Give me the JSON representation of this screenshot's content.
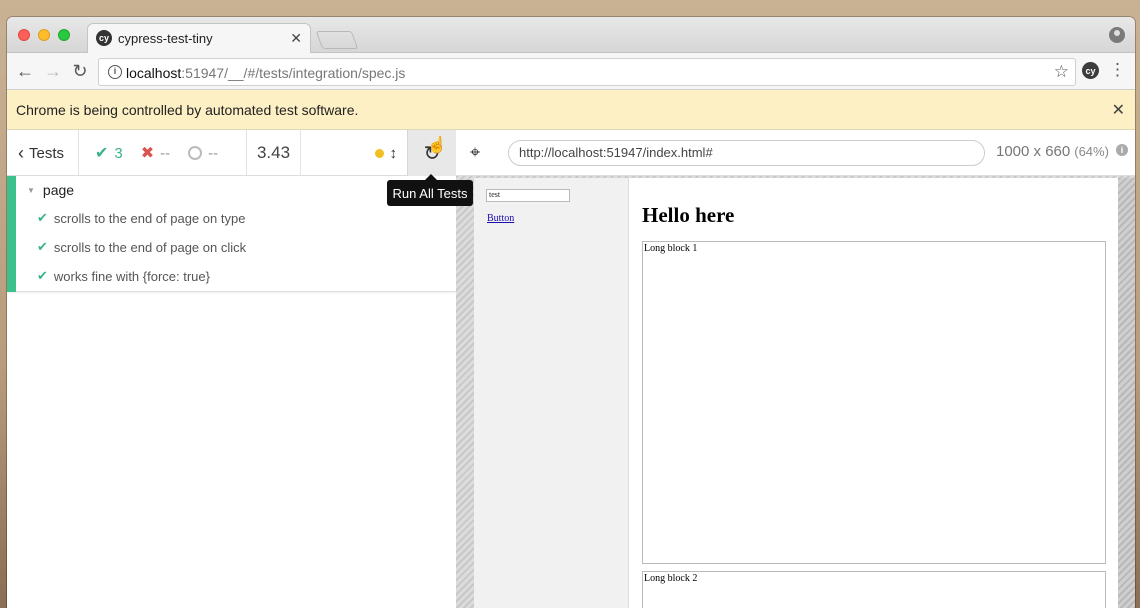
{
  "browser": {
    "tab_title": "cypress-test-tiny",
    "tab_favicon": "cy",
    "url_host": "localhost",
    "url_rest": ":51947/__/#/tests/integration/spec.js",
    "extension_icon": "cy",
    "infobar_text": "Chrome is being controlled by automated test software."
  },
  "reporter": {
    "back_label": "Tests",
    "passed": "3",
    "failed": "--",
    "pending": "--",
    "duration": "3.43",
    "rerun_tooltip": "Run All Tests",
    "suite_title": "page",
    "tests": [
      "scrolls to the end of page on type",
      "scrolls to the end of page on click",
      "works fine with {force: true}"
    ],
    "colors": {
      "pass": "#3bb18d",
      "fail": "#d9534f",
      "suite_bar": "#3cc18d"
    }
  },
  "aut": {
    "url": "http://localhost:51947/index.html#",
    "viewport": "1000 x 660",
    "scale": "(64%)",
    "input_value": "test",
    "button_label": "Button",
    "heading": "Hello here",
    "block1": "Long block 1",
    "block2": "Long block 2"
  }
}
